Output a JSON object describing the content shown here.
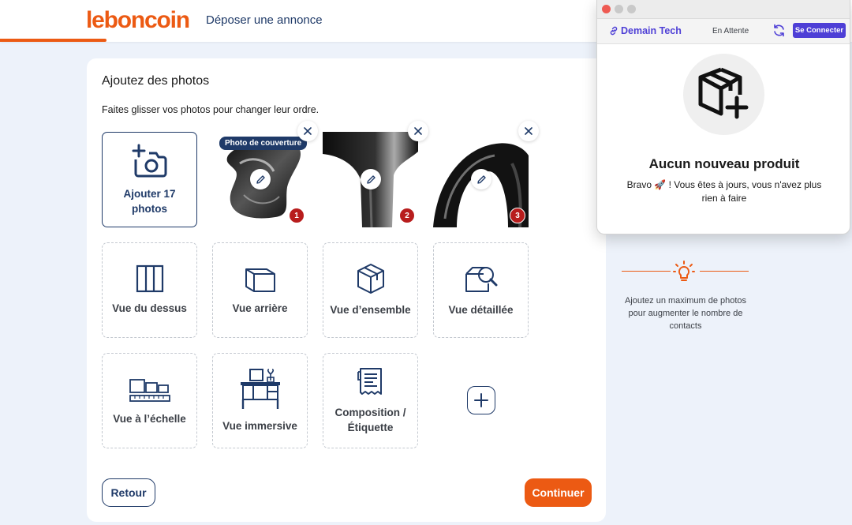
{
  "header": {
    "logo": "leboncoin",
    "deposer_link": "Déposer une annonce"
  },
  "main": {
    "title": "Ajoutez des photos",
    "subtitle": "Faites glisser vos photos pour changer leur ordre.",
    "add_tile_label": "Ajouter 17 photos",
    "cover_badge": "Photo de couverture",
    "photos": [
      {
        "number": "1"
      },
      {
        "number": "2"
      },
      {
        "number": "3"
      }
    ],
    "suggestions": [
      {
        "label": "Vue du dessus",
        "icon": "top-view-icon"
      },
      {
        "label": "Vue arrière",
        "icon": "back-view-icon"
      },
      {
        "label": "Vue d’ensemble",
        "icon": "overall-view-icon"
      },
      {
        "label": "Vue détaillée",
        "icon": "detail-view-icon"
      },
      {
        "label": "Vue à l’échelle",
        "icon": "scale-view-icon"
      },
      {
        "label": "Vue immersive",
        "icon": "immersive-view-icon"
      },
      {
        "label": "Composition / Étiquette",
        "icon": "label-icon"
      }
    ],
    "back_button": "Retour",
    "continue_button": "Continuer"
  },
  "tip": {
    "icon": "lightbulb-icon",
    "text": "Ajoutez un maximum de photos pour augmenter le nombre de contacts"
  },
  "popup": {
    "shop_name": "Demain Tech",
    "status": "En Attente",
    "connect_button": "Se Connecter",
    "empty_title": "Aucun nouveau produit",
    "empty_text": "Bravo 🚀 ! Vous êtes à jours, vous n'avez plus rien à faire"
  },
  "colors": {
    "brand_orange": "#ec5a13",
    "navy": "#1f3a68",
    "purple": "#4e3fd6",
    "badge_red": "#b81d1d"
  }
}
